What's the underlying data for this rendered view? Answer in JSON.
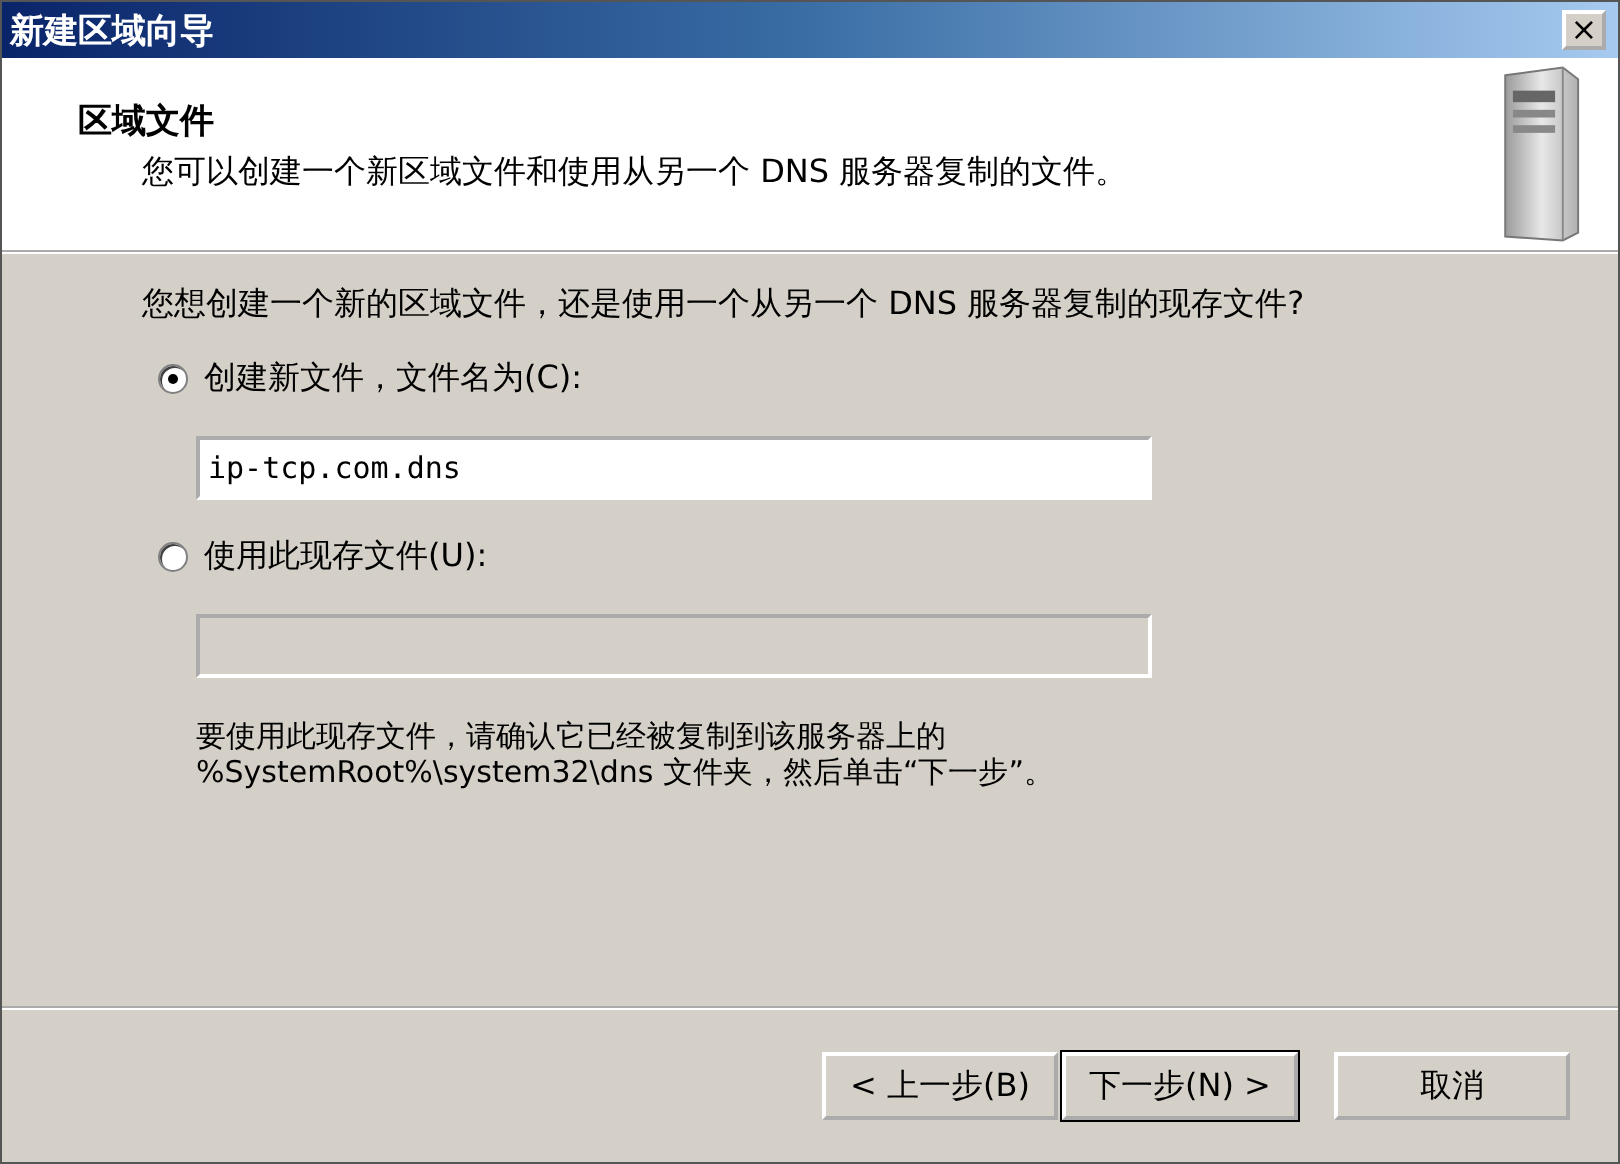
{
  "window": {
    "title": "新建区域向导",
    "close": "×"
  },
  "header": {
    "title": "区域文件",
    "subtitle": "您可以创建一个新区域文件和使用从另一个 DNS 服务器复制的文件。"
  },
  "question": "您想创建一个新的区域文件，还是使用一个从另一个 DNS 服务器复制的现存文件?",
  "options": [
    {
      "label": "创建新文件，文件名为(C):",
      "selected": true,
      "value": "ip-tcp.com.dns"
    },
    {
      "label": "使用此现存文件(U):",
      "selected": false
    }
  ],
  "note": "要使用此现存文件，请确认它已经被复制到该服务器上的 %SystemRoot%\\system32\\dns 文件夹，然后单击“下一步”。",
  "buttons": [
    {
      "label": "< 上一步(B)",
      "default": false
    },
    {
      "label": "下一步(N) >",
      "default": true
    },
    {
      "label": "取消",
      "default": false
    }
  ]
}
